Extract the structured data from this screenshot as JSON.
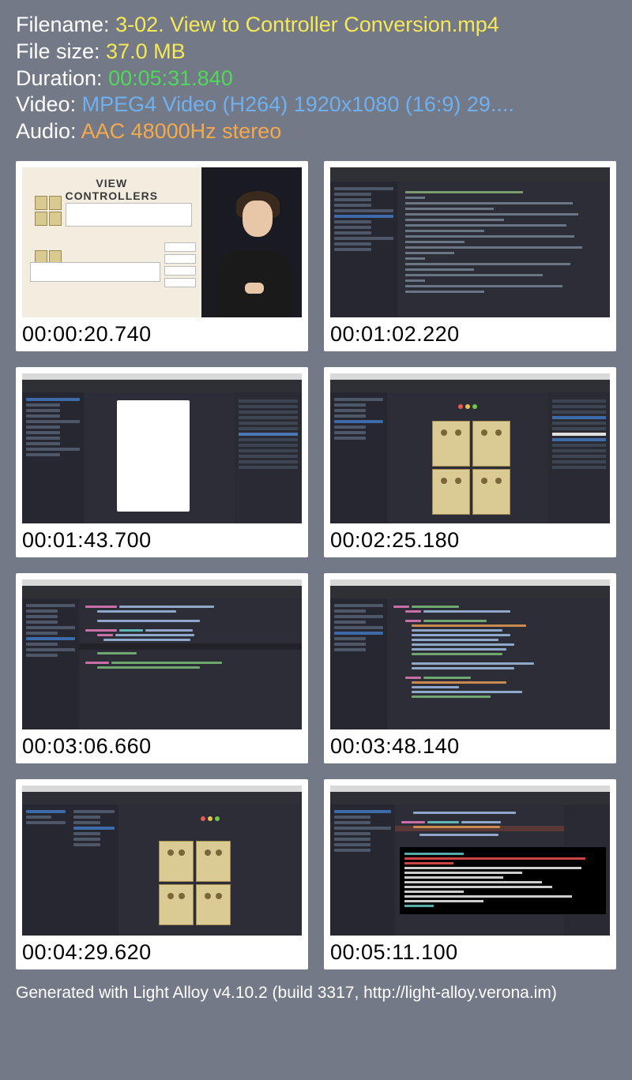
{
  "info": {
    "filename_label": "Filename: ",
    "filename_value": "3-02. View to Controller Conversion.mp4",
    "filesize_label": "File size: ",
    "filesize_value": "37.0 MB",
    "duration_label": "Duration: ",
    "duration_value": "00:05:31.840",
    "video_label": "Video: ",
    "video_value": "MPEG4 Video (H264) 1920x1080 (16:9) 29....",
    "audio_label": "Audio: ",
    "audio_value": "AAC 48000Hz stereo"
  },
  "thumbnails": [
    {
      "timestamp": "00:00:20.740",
      "title_text": "VIEW CONTROLLERS"
    },
    {
      "timestamp": "00:01:02.220"
    },
    {
      "timestamp": "00:01:43.700"
    },
    {
      "timestamp": "00:02:25.180"
    },
    {
      "timestamp": "00:03:06.660"
    },
    {
      "timestamp": "00:03:48.140"
    },
    {
      "timestamp": "00:04:29.620"
    },
    {
      "timestamp": "00:05:11.100"
    }
  ],
  "footer": "Generated with Light Alloy v4.10.2 (build 3317, http://light-alloy.verona.im)"
}
